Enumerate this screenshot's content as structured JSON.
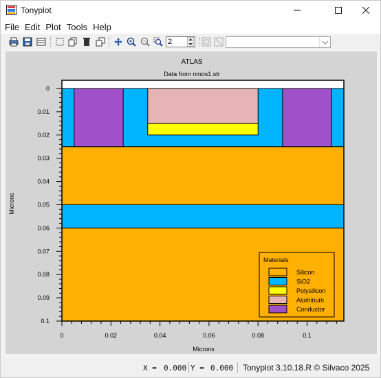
{
  "window": {
    "title": "Tonyplot",
    "controls": {
      "minimize": "minimize",
      "maximize": "maximize",
      "close": "close"
    }
  },
  "menu": {
    "items": [
      {
        "label": "File"
      },
      {
        "label": "Edit"
      },
      {
        "label": "Plot"
      },
      {
        "label": "Tools"
      },
      {
        "label": "Help"
      }
    ]
  },
  "toolbar": {
    "icons": [
      "print-icon",
      "save-icon",
      "export-icon",
      "select-icon",
      "copy-icon",
      "delete-icon",
      "duplicate-icon",
      "pan-icon",
      "zoom-in-icon",
      "zoom-out-icon",
      "zoom-box-icon",
      "overlay-icon",
      "unoverlay-icon"
    ],
    "zoom_value": "2",
    "plot_select_value": ""
  },
  "chart_data": {
    "type": "cross-section",
    "title": "ATLAS",
    "subtitle": "Data from nmos1.str",
    "xlabel": "Microns",
    "ylabel": "Microns",
    "xlim": [
      0,
      0.115
    ],
    "ylim": [
      0,
      0.1
    ],
    "y_inverted": true,
    "x_ticks": [
      "0",
      "0.02",
      "0.04",
      "0.06",
      "0.08",
      "0.1"
    ],
    "x_tick_values": [
      0,
      0.02,
      0.04,
      0.06,
      0.08,
      0.1
    ],
    "y_ticks": [
      "0",
      "0.01",
      "0.02",
      "0.03",
      "0.04",
      "0.05",
      "0.06",
      "0.07",
      "0.08",
      "0.09",
      "0.1"
    ],
    "y_tick_values": [
      0,
      0.01,
      0.02,
      0.03,
      0.04,
      0.05,
      0.06,
      0.07,
      0.08,
      0.09,
      0.1
    ],
    "legend": {
      "title": "Materials",
      "placement": "bottom-right",
      "entries": [
        {
          "name": "Silicon",
          "color": "#ffb000"
        },
        {
          "name": "SiO2",
          "color": "#00b4ff"
        },
        {
          "name": "Polysilicon",
          "color": "#ffff00"
        },
        {
          "name": "Aluminum",
          "color": "#e6b4b4"
        },
        {
          "name": "Conductor",
          "color": "#a050c8"
        }
      ]
    },
    "regions": [
      {
        "material": "Silicon",
        "x": [
          0,
          0.115
        ],
        "y": [
          0.025,
          0.05
        ]
      },
      {
        "material": "SiO2",
        "x": [
          0,
          0.115
        ],
        "y": [
          0.05,
          0.06
        ]
      },
      {
        "material": "Silicon",
        "x": [
          0,
          0.115
        ],
        "y": [
          0.06,
          0.1
        ]
      },
      {
        "material": "SiO2",
        "x": [
          0,
          0.115
        ],
        "y": [
          0,
          0.025
        ]
      },
      {
        "material": "Conductor",
        "x": [
          0.005,
          0.025
        ],
        "y": [
          0,
          0.025
        ]
      },
      {
        "material": "Conductor",
        "x": [
          0.09,
          0.11
        ],
        "y": [
          0,
          0.025
        ]
      },
      {
        "material": "Polysilicon",
        "x": [
          0.035,
          0.08
        ],
        "y": [
          0.015,
          0.02
        ]
      },
      {
        "material": "Aluminum",
        "x": [
          0.035,
          0.08
        ],
        "y": [
          0,
          0.015
        ]
      }
    ]
  },
  "status": {
    "x_label": "X = ",
    "x_value": "0.000",
    "y_label": "Y = ",
    "y_value": "0.000",
    "credit": "Tonyplot 3.10.18.R © Silvaco 2025"
  }
}
